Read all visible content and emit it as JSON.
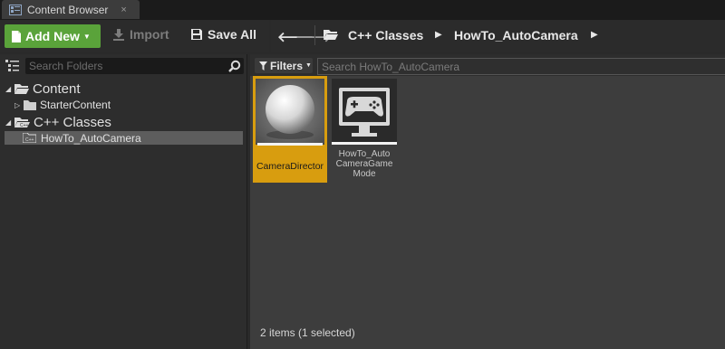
{
  "colors": {
    "accent_green": "#5aa33a",
    "selection_orange": "#d89d0f",
    "panel_dark": "#2d2d2d",
    "asset_area": "#3d3d3d"
  },
  "tab": {
    "title": "Content Browser",
    "icon": "content-browser-icon",
    "close": "×"
  },
  "toolbar": {
    "add_new_label": "Add New",
    "import_label": "Import",
    "save_all_label": "Save All"
  },
  "breadcrumb": {
    "back_glyph": "🡐",
    "forward_glyph": "🡒",
    "items": [
      "C++ Classes",
      "HowTo_AutoCamera"
    ],
    "separator": "▶"
  },
  "folders": {
    "search_placeholder": "Search Folders",
    "tree": [
      {
        "label": "Content",
        "expanded": true
      },
      {
        "label": "StarterContent",
        "expanded": false
      },
      {
        "label": "C++ Classes",
        "expanded": true
      },
      {
        "label": "HowTo_AutoCamera",
        "selected": true
      }
    ]
  },
  "assets": {
    "filters_label": "Filters",
    "search_placeholder": "Search HowTo_AutoCamera",
    "items": [
      {
        "name": "CameraDirector",
        "icon": "sphere-icon",
        "selected": true
      },
      {
        "name_lines": [
          "HowTo_Auto",
          "CameraGame",
          "Mode"
        ],
        "icon": "gamepad-monitor-icon",
        "selected": false
      }
    ],
    "status": "2 items (1 selected)"
  }
}
